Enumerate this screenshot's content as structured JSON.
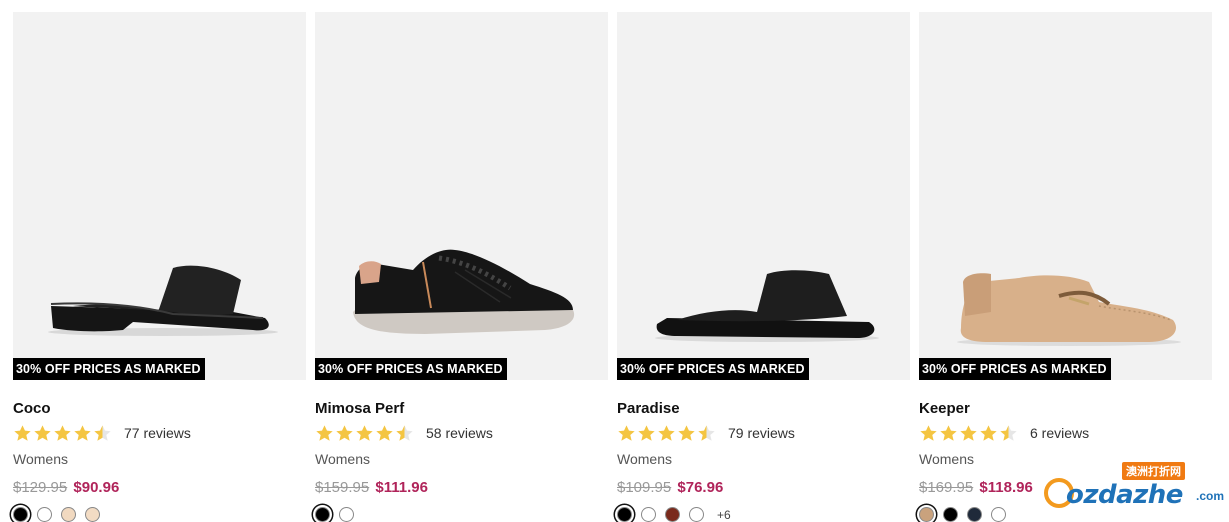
{
  "products": [
    {
      "name": "Coco",
      "promo": "30% OFF PRICES AS MARKED",
      "rating": 4.5,
      "reviews": "77 reviews",
      "category": "Womens",
      "was_price": "$129.95",
      "price": "$90.96",
      "swatches": [
        "#000000",
        "#ffffff",
        "#f1d9c0",
        "#f3dcc4"
      ],
      "more_colors": ""
    },
    {
      "name": "Mimosa Perf",
      "promo": "30% OFF PRICES AS MARKED",
      "rating": 4.5,
      "reviews": "58 reviews",
      "category": "Womens",
      "was_price": "$159.95",
      "price": "$111.96",
      "swatches": [
        "#000000",
        "#ffffff"
      ],
      "more_colors": ""
    },
    {
      "name": "Paradise",
      "promo": "30% OFF PRICES AS MARKED",
      "rating": 4.5,
      "reviews": "79 reviews",
      "category": "Womens",
      "was_price": "$109.95",
      "price": "$76.96",
      "swatches": [
        "#000000",
        "#ffffff",
        "#7a2a1c",
        "#ffffff"
      ],
      "more_colors": "+6"
    },
    {
      "name": "Keeper",
      "promo": "30% OFF PRICES AS MARKED",
      "rating": 4.5,
      "reviews": "6 reviews",
      "category": "Womens",
      "was_price": "$169.95",
      "price": "$118.96",
      "swatches": [
        "#c9a27d",
        "#000000",
        "#1f2a3a",
        "#ffffff"
      ],
      "more_colors": ""
    }
  ],
  "watermark": {
    "tag": "澳洲打折网",
    "text": "ozdazhe",
    "suffix": ".com"
  },
  "colors": {
    "sale_price": "#b0245a",
    "star": "#f4c542",
    "promo_bg": "#000000"
  }
}
